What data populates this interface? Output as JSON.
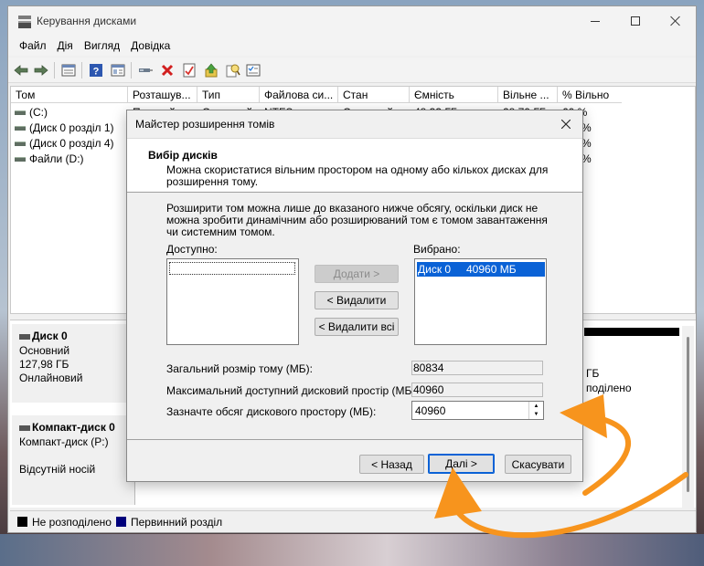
{
  "window": {
    "title": "Керування дисками",
    "controls": {
      "minimize": "minimize",
      "maximize": "maximize",
      "close": "close"
    }
  },
  "menu": [
    "Файл",
    "Дія",
    "Вигляд",
    "Довідка"
  ],
  "toolbar_icons": [
    "back-arrow-icon",
    "forward-arrow-icon",
    "list-view-icon",
    "help-icon",
    "properties-icon",
    "connect-icon",
    "delete-icon",
    "check-icon",
    "upload-icon",
    "search-icon",
    "settings-icon"
  ],
  "volumes": {
    "columns": [
      "Том",
      "Розташув...",
      "Тип",
      "Файлова си...",
      "Стан",
      "Ємність",
      "Вільне ...",
      "% Вільно"
    ],
    "rows": [
      {
        "name": "(C:)",
        "location": "Простий",
        "type": "Основний",
        "fs": "NTFS",
        "status": "Справний",
        "capacity": "48,33 ГБ",
        "free": "28,79 ГБ",
        "pct": "60 %"
      },
      {
        "name": "(Диск 0 розділ 1)",
        "pct": "%"
      },
      {
        "name": "(Диск 0 розділ 4)",
        "pct": "%"
      },
      {
        "name": "Файли (D:)",
        "pct": "%"
      }
    ]
  },
  "disks": [
    {
      "name": "Диск 0",
      "kind": "Основний",
      "size": "127,98 ГБ",
      "state": "Онлайновий",
      "partition_tail": [
        "ГБ",
        "поділено"
      ]
    },
    {
      "name": "Компакт-диск 0",
      "kind": "Компакт-диск (P:)",
      "state": "Відсутній носій"
    }
  ],
  "legend": [
    {
      "label": "Не розподілено",
      "color": "#000000"
    },
    {
      "label": "Первинний розділ",
      "color": "#00007b"
    }
  ],
  "dialog": {
    "title": "Майстер розширення томів",
    "header_title": "Вибір дисків",
    "header_sub": "Можна скористатися вільним простором на одному або кількох дисках для розширення тому.",
    "description": "Розширити том можна лише до вказаного нижче обсягу, оскільки диск не можна зробити динамічним або розширюваний том є томом завантаження чи системним томом.",
    "available_label": "Доступно:",
    "selected_label": "Вибрано:",
    "selected_items": [
      {
        "disk": "Диск 0",
        "size": "40960 МБ"
      }
    ],
    "add_button": "Додати >",
    "remove_button": "< Видалити",
    "remove_all_button": "< Видалити всі",
    "total_label": "Загальний розмір тому (МБ):",
    "total_value": "80834",
    "max_label": "Максимальний доступний дисковий простір (МБ):",
    "max_value": "40960",
    "amount_label": "Зазначте обсяг дискового простору (МБ):",
    "amount_value": "40960",
    "back_button": "< Назад",
    "next_button": "Далі >",
    "cancel_button": "Скасувати"
  },
  "colors": {
    "accent": "#0a62d6",
    "annotation": "#f7941d"
  }
}
